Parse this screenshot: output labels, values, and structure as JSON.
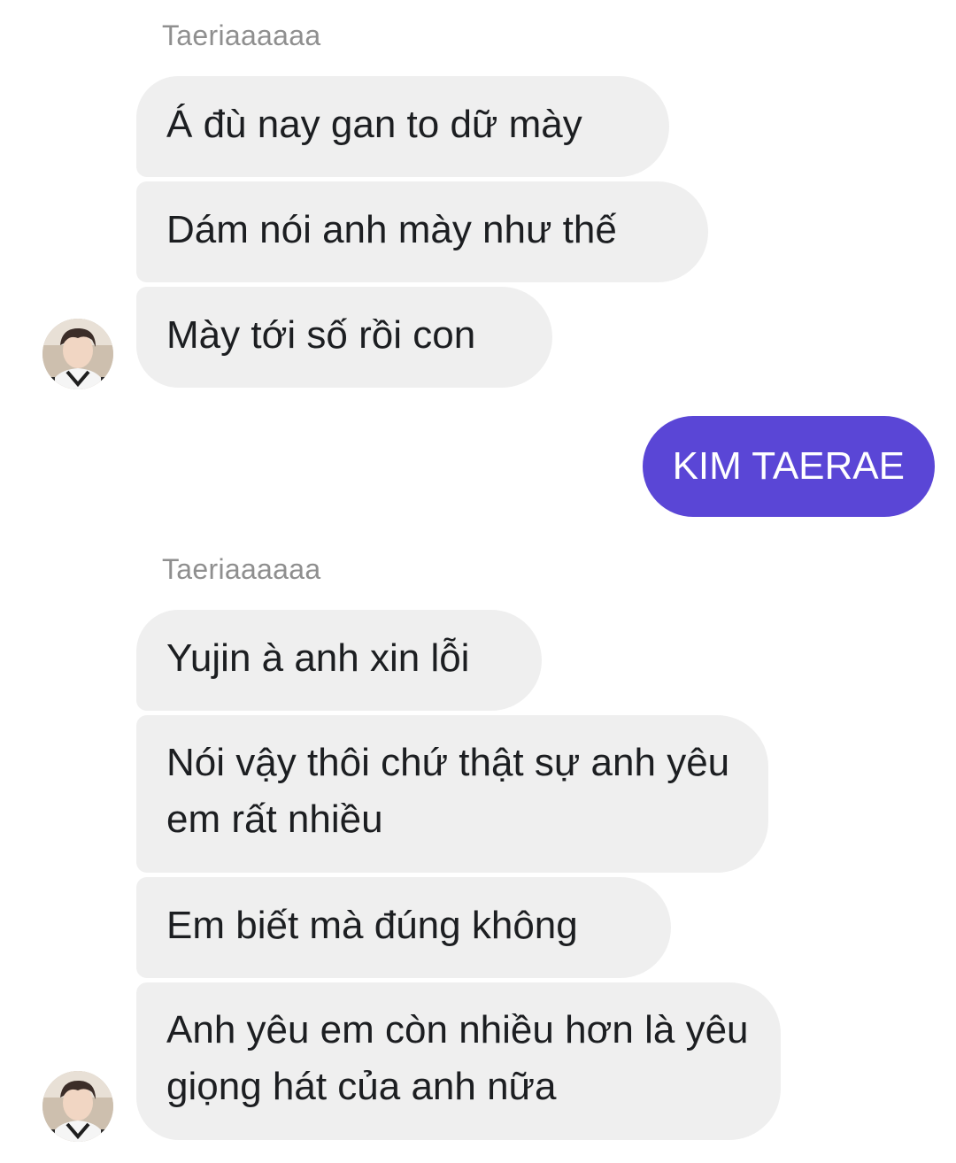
{
  "conversation": {
    "groups": [
      {
        "sender": "Taeriaaaaaa",
        "messages": [
          "Á đù nay gan to dữ mày",
          "Dám nói anh mày như thế",
          "Mày tới số rồi con"
        ]
      },
      {
        "sender": "Taeriaaaaaa",
        "messages": [
          "Yujin à anh xin lỗi",
          "Nói vậy thôi chứ thật sự anh yêu em rất nhiều",
          "Em biết mà đúng không",
          "Anh yêu em còn nhiều hơn là yêu giọng hát của anh nữa"
        ]
      }
    ],
    "sent": {
      "text": "KIM TAERAE"
    }
  },
  "colors": {
    "received_bubble": "#efefef",
    "sent_bubble": "#5a46d6",
    "sender_name": "#8f8f8f"
  },
  "icons": {
    "avatar": "user-avatar-photo"
  }
}
